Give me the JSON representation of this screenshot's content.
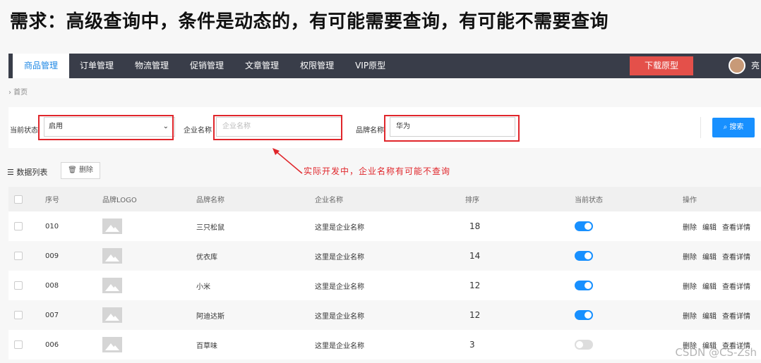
{
  "slide_title": "需求：高级查询中，条件是动态的，有可能需要查询，有可能不需要查询",
  "nav": {
    "tabs": [
      "商品管理",
      "订单管理",
      "物流管理",
      "促销管理",
      "文章管理",
      "权限管理",
      "VIP原型"
    ],
    "download_label": "下载原型",
    "user_name": "亮"
  },
  "breadcrumb": "› 首页",
  "filters": {
    "status_label": "当前状态",
    "status_value": "启用",
    "company_label": "企业名称",
    "company_placeholder": "企业名称",
    "brand_label": "品牌名称",
    "brand_value": "华为",
    "search_label": "搜索"
  },
  "annotation": "实际开发中，企业名称有可能不查询",
  "list": {
    "title": "数据列表",
    "delete_label": "删除"
  },
  "table": {
    "headers": [
      "序号",
      "品牌LOGO",
      "品牌名称",
      "企业名称",
      "排序",
      "当前状态",
      "操作"
    ],
    "rows": [
      {
        "id": "010",
        "brand": "三只松鼠",
        "company": "这里是企业名称",
        "order": "18",
        "enabled": true
      },
      {
        "id": "009",
        "brand": "优衣库",
        "company": "这里是企业名称",
        "order": "14",
        "enabled": true
      },
      {
        "id": "008",
        "brand": "小米",
        "company": "这里是企业名称",
        "order": "12",
        "enabled": true
      },
      {
        "id": "007",
        "brand": "阿迪达斯",
        "company": "这里是企业名称",
        "order": "12",
        "enabled": true
      },
      {
        "id": "006",
        "brand": "百草味",
        "company": "这里是企业名称",
        "order": "3",
        "enabled": false
      }
    ],
    "actions": [
      "删除",
      "编辑",
      "查看详情"
    ]
  },
  "watermark": "CSDN @CS-Zsh",
  "colors": {
    "nav_bg": "#393d49",
    "accent": "#1890ff",
    "highlight_red": "#e0262b",
    "download_btn": "#e4504a"
  }
}
